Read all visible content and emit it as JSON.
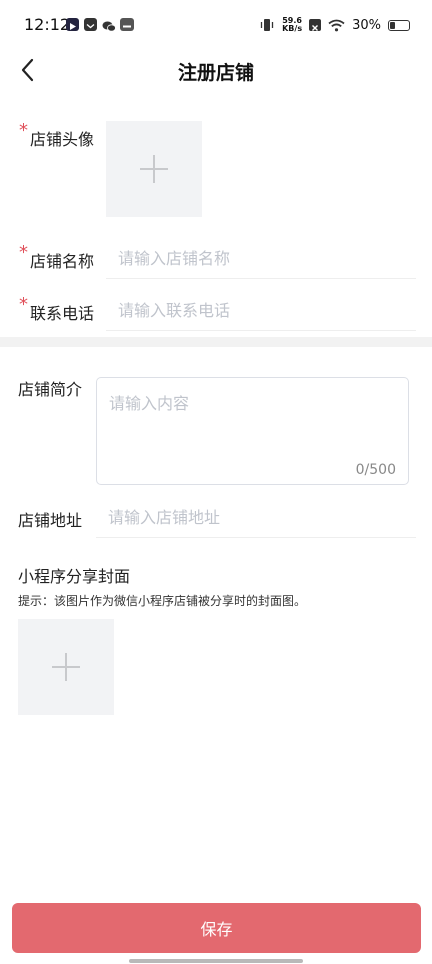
{
  "status_bar": {
    "time": "12:12",
    "net_speed_value": "59.6",
    "net_speed_unit": "KB/s",
    "battery_percent": "30%",
    "battery_level": 0.3,
    "icons": [
      "play-app-icon",
      "mail-app-icon",
      "wechat-icon",
      "app-icon",
      "vibrate-icon",
      "sim-icon",
      "wifi-icon",
      "battery-icon"
    ]
  },
  "header": {
    "title": "注册店铺",
    "back_icon": "chevron-left-icon"
  },
  "form": {
    "avatar_label": "店铺头像",
    "name_label": "店铺名称",
    "name_placeholder": "请输入店铺名称",
    "phone_label": "联系电话",
    "phone_placeholder": "请输入联系电话",
    "required_mark": "*",
    "intro_label": "店铺简介",
    "intro_placeholder": "请输入内容",
    "intro_count": "0/500",
    "address_label": "店铺地址",
    "address_placeholder": "请输入店铺地址",
    "cover_title": "小程序分享封面",
    "cover_hint": "提示：该图片作为微信小程序店铺被分享时的封面图。"
  },
  "footer": {
    "save_label": "保存"
  },
  "colors": {
    "required": "#e0505a",
    "save_button": "#e3696f",
    "upload_bg": "#f2f3f5",
    "placeholder": "#c0c4cc"
  }
}
